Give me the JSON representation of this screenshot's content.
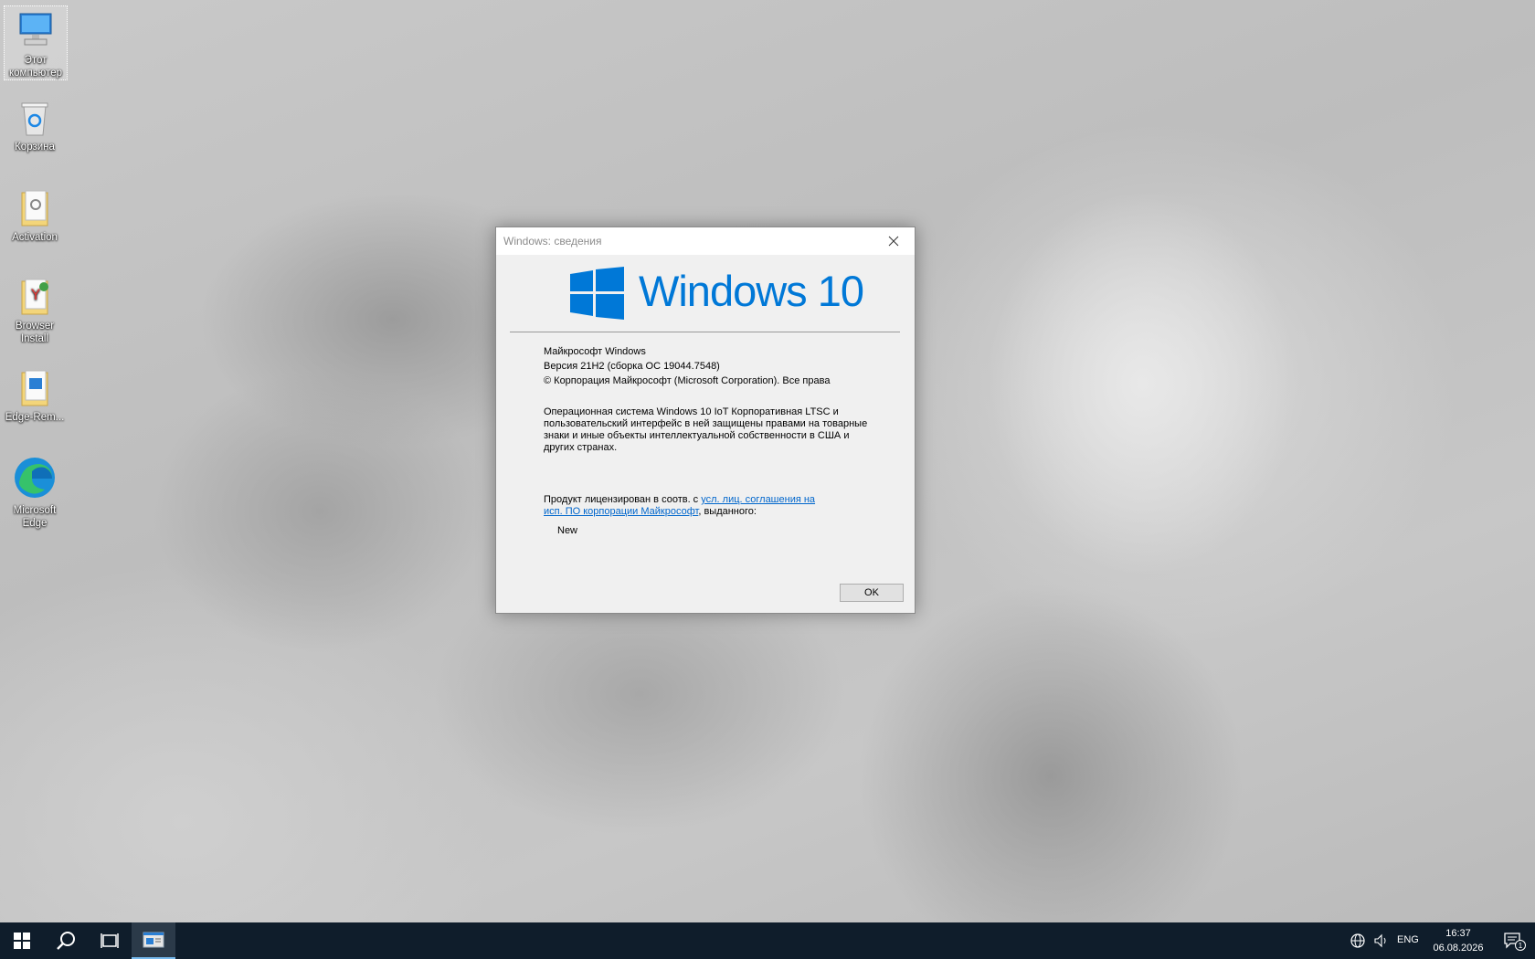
{
  "desktop": {
    "icons": [
      {
        "label": "Этот компьютер",
        "icon": "this-pc-icon"
      },
      {
        "label": "Корзина",
        "icon": "recycle-bin-icon"
      },
      {
        "label": "Activation",
        "icon": "folder-icon"
      },
      {
        "label": "Browser Install",
        "icon": "folder-icon"
      },
      {
        "label": "Edge-Rem...",
        "icon": "folder-icon"
      },
      {
        "label": "Microsoft Edge",
        "icon": "edge-icon"
      }
    ]
  },
  "dialog": {
    "title": "Windows: сведения",
    "logo_text": "Windows 10",
    "product": "Майкрософт Windows",
    "version": "Версия 21H2 (сборка ОС 19044.7548)",
    "copyright": "© Корпорация Майкрософт (Microsoft Corporation). Все права",
    "description": "Операционная система Windows 10 IoT Корпоративная LTSC и пользовательский интерфейс в ней защищены правами на товарные знаки и иные объекты интеллектуальной собственности в США и других странах.",
    "license_prefix": "Продукт лицензирован в соотв. с ",
    "license_link": "усл. лиц. соглашения на исп. ПО корпорации Майкрософт",
    "license_suffix": ", выданного:",
    "licensee": "New",
    "ok_label": "OK"
  },
  "taskbar": {
    "language": "ENG",
    "time": "16:37",
    "date": "06.08.2026",
    "notification_count": "1"
  },
  "colors": {
    "accent": "#0078d7",
    "taskbar": "#0f1d2b",
    "link": "#0066cc"
  }
}
